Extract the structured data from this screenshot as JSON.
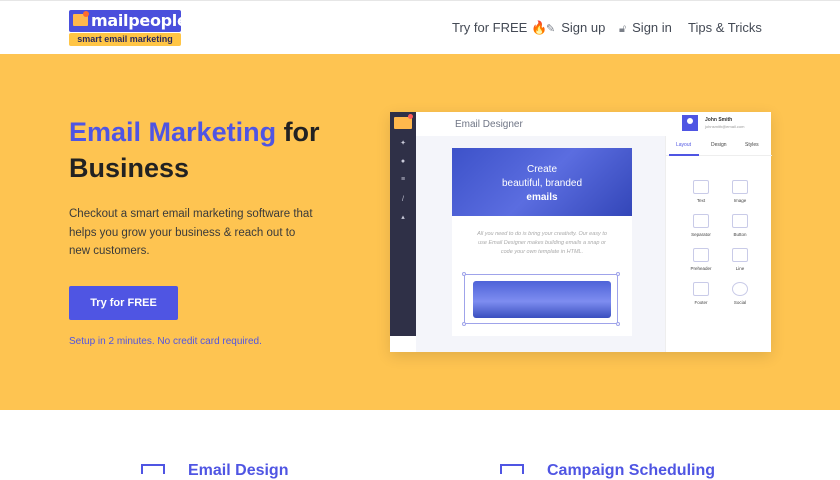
{
  "nav": {
    "logo": {
      "word": "mailpeople",
      "tagline": "smart email marketing"
    },
    "items": [
      {
        "label": "Try for FREE 🔥",
        "icon": ""
      },
      {
        "label": "Sign up",
        "icon": "pencil-icon"
      },
      {
        "label": "Sign in",
        "icon": "lock-icon"
      },
      {
        "label": "Tips & Tricks",
        "icon": ""
      }
    ]
  },
  "hero": {
    "title_accent": "Email Marketing",
    "title_rest": " for Business",
    "description": "Checkout a smart email marketing software that helps you grow your business & reach out to new customers.",
    "cta_label": "Try for FREE",
    "cta_note": "Setup in 2 minutes. No credit card required."
  },
  "mockup": {
    "title": "Email Designer",
    "user_name": "John Smith",
    "user_email": "johnsmith@email.com",
    "tabs": [
      "Layout",
      "Design",
      "Styles"
    ],
    "widgets": [
      "Text",
      "Image",
      "Separator",
      "Button",
      "Preheader",
      "Line",
      "Footer",
      "Social"
    ],
    "email_hero": [
      "Create",
      "beautiful, branded",
      "emails"
    ],
    "email_text": "All you need to do is bring your creativity. Our easy to use Email Designer makes building emails a snap or code your own template in HTML."
  },
  "features": [
    {
      "label": "Email Design"
    },
    {
      "label": "Campaign Scheduling"
    }
  ],
  "colors": {
    "brand": "#4f55e3",
    "hero_bg": "#fec451",
    "text": "#222222"
  }
}
